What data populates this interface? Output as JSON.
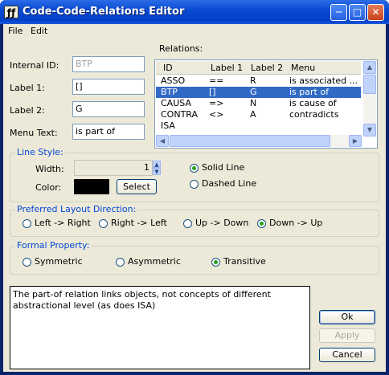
{
  "window": {
    "title": "Code-Code-Relations Editor",
    "app_icon": "ƒƒ"
  },
  "menubar": {
    "file": "File",
    "edit": "Edit"
  },
  "form": {
    "internal_id_label": "Internal ID:",
    "internal_id_value": "BTP",
    "label1_label": "Label 1:",
    "label1_value": "[]",
    "label2_label": "Label 2:",
    "label2_value": "G",
    "menu_text_label": "Menu Text:",
    "menu_text_value": "is part of"
  },
  "relations": {
    "title": "Relations:",
    "columns": [
      "ID",
      "Label 1",
      "Label 2",
      "Menu"
    ],
    "rows": [
      {
        "id": "ASSO",
        "label1": "==",
        "label2": "R",
        "menu": "is associated ..."
      },
      {
        "id": "BTP",
        "label1": "[]",
        "label2": "G",
        "menu": "is part of"
      },
      {
        "id": "CAUSA",
        "label1": "=>",
        "label2": "N",
        "menu": "is cause of"
      },
      {
        "id": "CONTRA",
        "label1": "<>",
        "label2": "A",
        "menu": "contradicts"
      },
      {
        "id": "ISA",
        "label1": "",
        "label2": "",
        "menu": ""
      }
    ],
    "selected_row": 1
  },
  "line_style": {
    "title": "Line Style:",
    "width_label": "Width:",
    "width_value": "1",
    "color_label": "Color:",
    "color_value": "#000000",
    "select_button": "Select",
    "solid_line": "Solid Line",
    "dashed_line": "Dashed Line",
    "selected": "solid"
  },
  "layout_direction": {
    "title": "Preferred Layout Direction:",
    "options": [
      "Left -> Right",
      "Right -> Left",
      "Up -> Down",
      "Down -> Up"
    ],
    "selected": "Down -> Up"
  },
  "formal_property": {
    "title": "Formal Property:",
    "options": [
      "Symmetric",
      "Asymmetric",
      "Transitive"
    ],
    "selected": "Transitive"
  },
  "description": "The part-of relation links objects, not concepts of different abstractional level (as does ISA)",
  "buttons": {
    "ok": "Ok",
    "apply": "Apply",
    "cancel": "Cancel"
  }
}
